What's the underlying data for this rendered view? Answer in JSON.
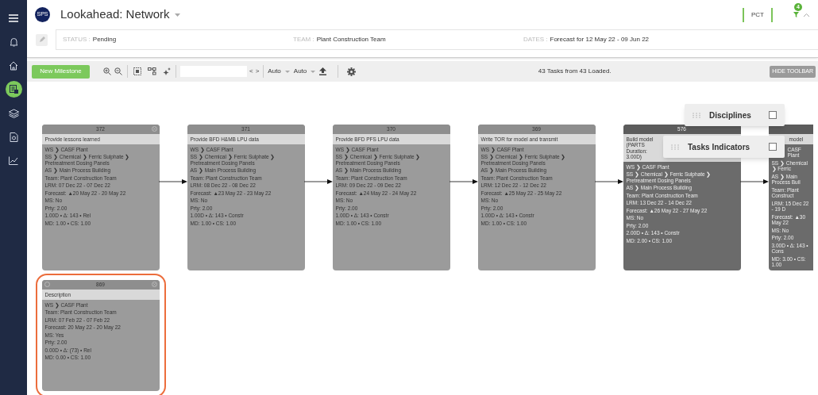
{
  "sidebar": {
    "items": [
      {
        "kind": "menu",
        "selected": false
      },
      {
        "kind": "bell",
        "selected": false
      },
      {
        "kind": "home",
        "selected": false
      },
      {
        "kind": "list",
        "selected": true
      },
      {
        "kind": "layers",
        "selected": false
      },
      {
        "kind": "document",
        "selected": false
      },
      {
        "kind": "chart",
        "selected": false
      }
    ]
  },
  "header": {
    "logo": "SPS",
    "title": "Lookahead: Network",
    "pct": "PCT",
    "filter_count": "4"
  },
  "info": [
    {
      "label": "STATUS :",
      "value": "Pending"
    },
    {
      "label": "TEAM :",
      "value": "Plant Construction Team"
    },
    {
      "label": "DATES :",
      "value": "Forecast for 12 May 22 - 09 Jun 22"
    }
  ],
  "toolbar": {
    "new_button": "New Milestone",
    "prev": "<",
    "next": ">",
    "selects": [
      "Auto",
      "Auto"
    ],
    "summary": "43 Tasks from 43 Loaded.",
    "hide_button": "HIDE TOOLBAR"
  },
  "network": {
    "rows": [
      {
        "runs_off_edge": true,
        "nodes": [
          {
            "number": "372",
            "title": [
              "Provide lessons learned"
            ],
            "dark": false,
            "selected": false,
            "closable": true,
            "marker": false,
            "lines": [
              "WS ❯ CASF Plant",
              "SS ❯ Chemical ❯ Ferric Sulphate ❯ Pretreatment Dosing Panels",
              "AS ❯ Main Process Building",
              "Team: Plant Construction Team",
              "LRM: 07 Dec 22 - 07 Dec 22",
              "Forecast:  ▲20 May 22 - 20 May 22",
              "MS: No",
              "Prty: 2.00",
              "1.00D • Δ: 143 • Rel",
              "MD: 1.00 • CS: 1.00"
            ]
          },
          {
            "number": "371",
            "title": [
              "Provide BFD H&MB LPU data"
            ],
            "dark": false,
            "selected": false,
            "closable": false,
            "marker": false,
            "lines": [
              "WS ❯ CASF Plant",
              "SS ❯ Chemical ❯ Ferric Sulphate ❯ Pretreatment Dosing Panels",
              "AS ❯ Main Process Building",
              "Team: Plant Construction Team",
              "LRM: 08 Dec 22 - 08 Dec 22",
              "Forecast:  ▲23 May 22 - 23 May 22",
              "MS: No",
              "Prty: 2.00",
              "1.00D • Δ: 143 • Constr",
              "MD: 1.00 • CS: 1.00"
            ]
          },
          {
            "number": "370",
            "title": [
              "Provide BFD PFS LPU data"
            ],
            "dark": false,
            "selected": false,
            "closable": false,
            "marker": false,
            "lines": [
              "WS ❯ CASF Plant",
              "SS ❯ Chemical ❯ Ferric Sulphate ❯ Pretreatment Dosing Panels",
              "AS ❯ Main Process Building",
              "Team: Plant Construction Team",
              "LRM: 09 Dec 22 - 09 Dec 22",
              "Forecast:  ▲24 May 22 - 24 May 22",
              "MS: No",
              "Prty: 2.00",
              "1.00D • Δ: 143 • Constr",
              "MD: 1.00 • CS: 1.00"
            ]
          },
          {
            "number": "369",
            "title": [
              "Write TOR for model and transmit"
            ],
            "dark": false,
            "selected": false,
            "closable": false,
            "marker": false,
            "lines": [
              "WS ❯ CASF Plant",
              "SS ❯ Chemical ❯ Ferric Sulphate ❯ Pretreatment Dosing Panels",
              "AS ❯ Main Process Building",
              "Team: Plant Construction Team",
              "LRM: 12 Dec 22 - 12 Dec 22",
              "Forecast:  ▲25 May 22 - 25 May 22",
              "MS: No",
              "Prty: 2.00",
              "1.00D • Δ: 143 • Constr",
              "MD: 1.00 • CS: 1.00"
            ]
          },
          {
            "number": "576",
            "title": [
              "Build model (PARTS",
              "Duration: 3.00D)"
            ],
            "dark": true,
            "selected": false,
            "closable": false,
            "marker": false,
            "covered_left": false,
            "covered_right": true,
            "lines": [
              "WS ❯ CASF Plant",
              "SS ❯ Chemical ❯ Ferric Sulphate ❯ Pretreatment Dosing Panels",
              "AS ❯ Main Process Building",
              "Team: Plant Construction Team",
              "LRM: 13 Dec 22 - 14 Dec 22",
              "Forecast:  ▲26 May 22 - 27 May 22",
              "MS: No",
              "Prty: 2.00",
              "2.00D • Δ: 143 • Constr",
              "MD: 2.00 • CS: 1.00"
            ]
          },
          {
            "title": [
              "model"
            ],
            "dark": true,
            "selected": false,
            "closable": false,
            "marker": false,
            "covered_left": true,
            "covered_right": false,
            "lines": [
              "CASF Plant",
              "SS ❯ Chemical ❯ Ferric",
              "AS ❯ Main Process Buil",
              "Team: Plant Construct",
              "LRM: 15 Dec 22 - 19 D",
              "Forecast:  ▲30 May 22",
              "MS: No",
              "Prty: 2.00",
              "3.00D • Δ: 143 • Cons",
              "MD: 3.00 • CS: 1.00"
            ]
          }
        ]
      },
      {
        "runs_off_edge": false,
        "nodes": [
          {
            "number": "869",
            "title": [
              "Description"
            ],
            "dark": false,
            "selected": true,
            "closable": true,
            "marker": true,
            "lines": [
              "WS ❯ CASF Plant",
              "Team: Plant Construction Team",
              "LRM: 07 Feb 22 - 07 Feb 22",
              "Forecast: 20 May 22 - 20 May 22",
              "MS: Yes",
              "Prty: 2.00",
              "0.00D • Δ: (73) • Rel",
              "MD: 0.00 • CS: 1.00"
            ]
          }
        ]
      }
    ]
  },
  "panels": [
    {
      "label": "Disciplines",
      "checked": false
    },
    {
      "label": "Tasks Indicators",
      "checked": false
    }
  ]
}
